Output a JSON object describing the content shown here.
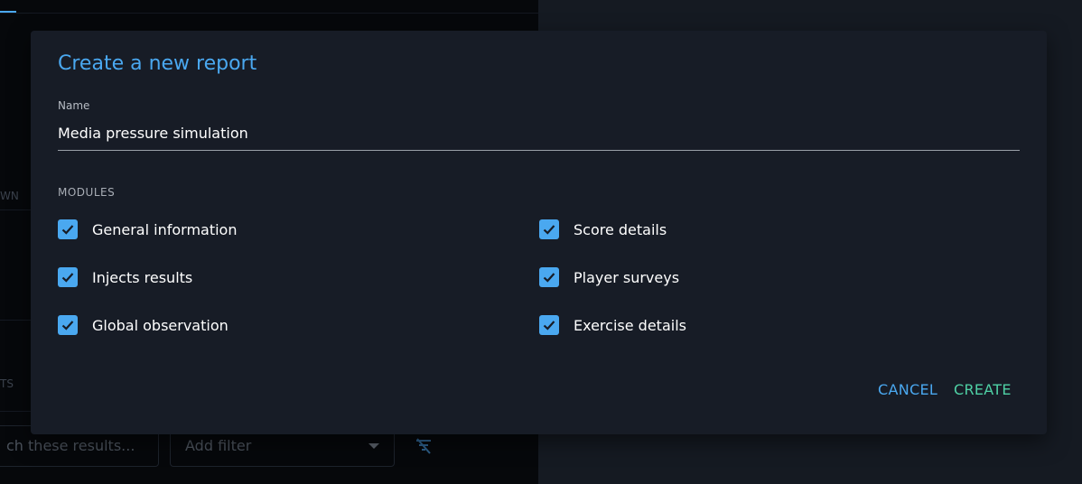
{
  "background": {
    "fragment_1": "WN",
    "fragment_2": "TS",
    "search_placeholder": "ch these results...",
    "filter_placeholder": "Add filter",
    "filter_icon": "filter-off-icon"
  },
  "dialog": {
    "title": "Create a new report",
    "name_label": "Name",
    "name_value": "Media pressure simulation",
    "modules_label": "MODULES",
    "modules": [
      {
        "label": "General information",
        "checked": true
      },
      {
        "label": "Score details",
        "checked": true
      },
      {
        "label": "Injects results",
        "checked": true
      },
      {
        "label": "Player surveys",
        "checked": true
      },
      {
        "label": "Global observation",
        "checked": true
      },
      {
        "label": "Exercise details",
        "checked": true
      }
    ],
    "cancel_label": "CANCEL",
    "create_label": "CREATE"
  },
  "colors": {
    "accent": "#4aa8f0",
    "create": "#4fd1a5",
    "dialog_bg": "#171c26"
  }
}
